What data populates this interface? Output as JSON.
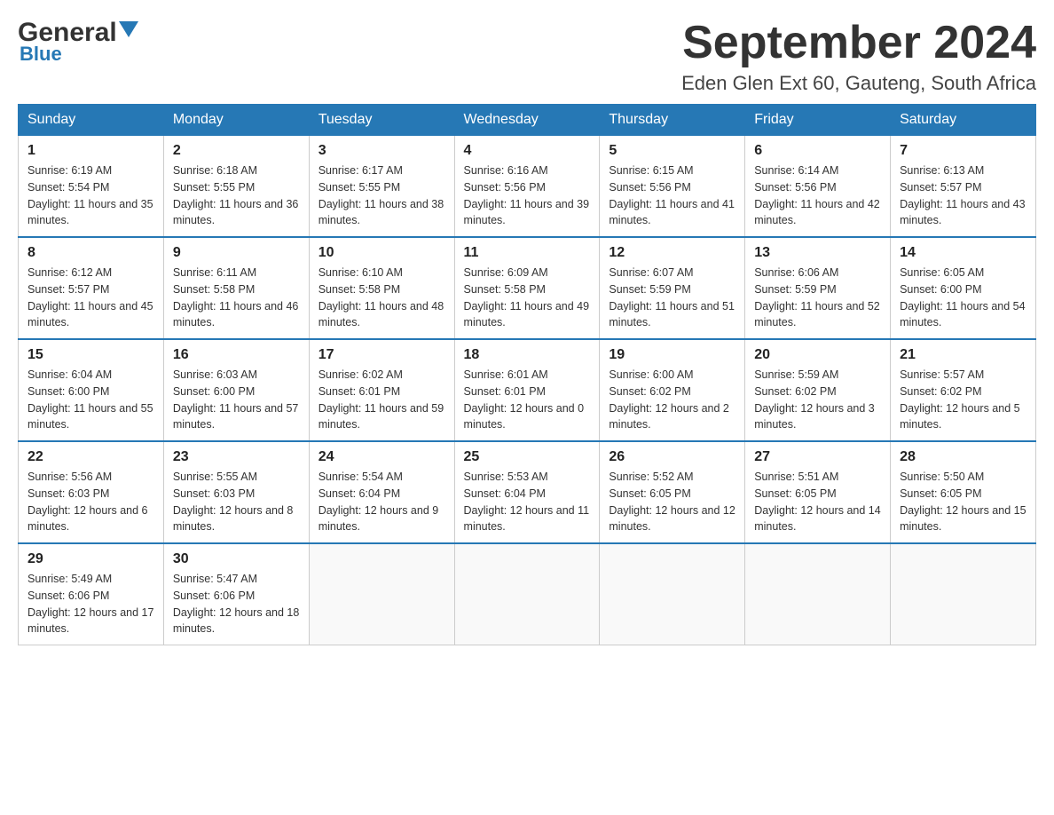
{
  "header": {
    "logo_general": "General",
    "logo_blue": "Blue",
    "month_title": "September 2024",
    "location": "Eden Glen Ext 60, Gauteng, South Africa"
  },
  "days_of_week": [
    "Sunday",
    "Monday",
    "Tuesday",
    "Wednesday",
    "Thursday",
    "Friday",
    "Saturday"
  ],
  "weeks": [
    [
      {
        "date": "1",
        "sunrise": "6:19 AM",
        "sunset": "5:54 PM",
        "daylight": "11 hours and 35 minutes."
      },
      {
        "date": "2",
        "sunrise": "6:18 AM",
        "sunset": "5:55 PM",
        "daylight": "11 hours and 36 minutes."
      },
      {
        "date": "3",
        "sunrise": "6:17 AM",
        "sunset": "5:55 PM",
        "daylight": "11 hours and 38 minutes."
      },
      {
        "date": "4",
        "sunrise": "6:16 AM",
        "sunset": "5:56 PM",
        "daylight": "11 hours and 39 minutes."
      },
      {
        "date": "5",
        "sunrise": "6:15 AM",
        "sunset": "5:56 PM",
        "daylight": "11 hours and 41 minutes."
      },
      {
        "date": "6",
        "sunrise": "6:14 AM",
        "sunset": "5:56 PM",
        "daylight": "11 hours and 42 minutes."
      },
      {
        "date": "7",
        "sunrise": "6:13 AM",
        "sunset": "5:57 PM",
        "daylight": "11 hours and 43 minutes."
      }
    ],
    [
      {
        "date": "8",
        "sunrise": "6:12 AM",
        "sunset": "5:57 PM",
        "daylight": "11 hours and 45 minutes."
      },
      {
        "date": "9",
        "sunrise": "6:11 AM",
        "sunset": "5:58 PM",
        "daylight": "11 hours and 46 minutes."
      },
      {
        "date": "10",
        "sunrise": "6:10 AM",
        "sunset": "5:58 PM",
        "daylight": "11 hours and 48 minutes."
      },
      {
        "date": "11",
        "sunrise": "6:09 AM",
        "sunset": "5:58 PM",
        "daylight": "11 hours and 49 minutes."
      },
      {
        "date": "12",
        "sunrise": "6:07 AM",
        "sunset": "5:59 PM",
        "daylight": "11 hours and 51 minutes."
      },
      {
        "date": "13",
        "sunrise": "6:06 AM",
        "sunset": "5:59 PM",
        "daylight": "11 hours and 52 minutes."
      },
      {
        "date": "14",
        "sunrise": "6:05 AM",
        "sunset": "6:00 PM",
        "daylight": "11 hours and 54 minutes."
      }
    ],
    [
      {
        "date": "15",
        "sunrise": "6:04 AM",
        "sunset": "6:00 PM",
        "daylight": "11 hours and 55 minutes."
      },
      {
        "date": "16",
        "sunrise": "6:03 AM",
        "sunset": "6:00 PM",
        "daylight": "11 hours and 57 minutes."
      },
      {
        "date": "17",
        "sunrise": "6:02 AM",
        "sunset": "6:01 PM",
        "daylight": "11 hours and 59 minutes."
      },
      {
        "date": "18",
        "sunrise": "6:01 AM",
        "sunset": "6:01 PM",
        "daylight": "12 hours and 0 minutes."
      },
      {
        "date": "19",
        "sunrise": "6:00 AM",
        "sunset": "6:02 PM",
        "daylight": "12 hours and 2 minutes."
      },
      {
        "date": "20",
        "sunrise": "5:59 AM",
        "sunset": "6:02 PM",
        "daylight": "12 hours and 3 minutes."
      },
      {
        "date": "21",
        "sunrise": "5:57 AM",
        "sunset": "6:02 PM",
        "daylight": "12 hours and 5 minutes."
      }
    ],
    [
      {
        "date": "22",
        "sunrise": "5:56 AM",
        "sunset": "6:03 PM",
        "daylight": "12 hours and 6 minutes."
      },
      {
        "date": "23",
        "sunrise": "5:55 AM",
        "sunset": "6:03 PM",
        "daylight": "12 hours and 8 minutes."
      },
      {
        "date": "24",
        "sunrise": "5:54 AM",
        "sunset": "6:04 PM",
        "daylight": "12 hours and 9 minutes."
      },
      {
        "date": "25",
        "sunrise": "5:53 AM",
        "sunset": "6:04 PM",
        "daylight": "12 hours and 11 minutes."
      },
      {
        "date": "26",
        "sunrise": "5:52 AM",
        "sunset": "6:05 PM",
        "daylight": "12 hours and 12 minutes."
      },
      {
        "date": "27",
        "sunrise": "5:51 AM",
        "sunset": "6:05 PM",
        "daylight": "12 hours and 14 minutes."
      },
      {
        "date": "28",
        "sunrise": "5:50 AM",
        "sunset": "6:05 PM",
        "daylight": "12 hours and 15 minutes."
      }
    ],
    [
      {
        "date": "29",
        "sunrise": "5:49 AM",
        "sunset": "6:06 PM",
        "daylight": "12 hours and 17 minutes."
      },
      {
        "date": "30",
        "sunrise": "5:47 AM",
        "sunset": "6:06 PM",
        "daylight": "12 hours and 18 minutes."
      },
      null,
      null,
      null,
      null,
      null
    ]
  ]
}
